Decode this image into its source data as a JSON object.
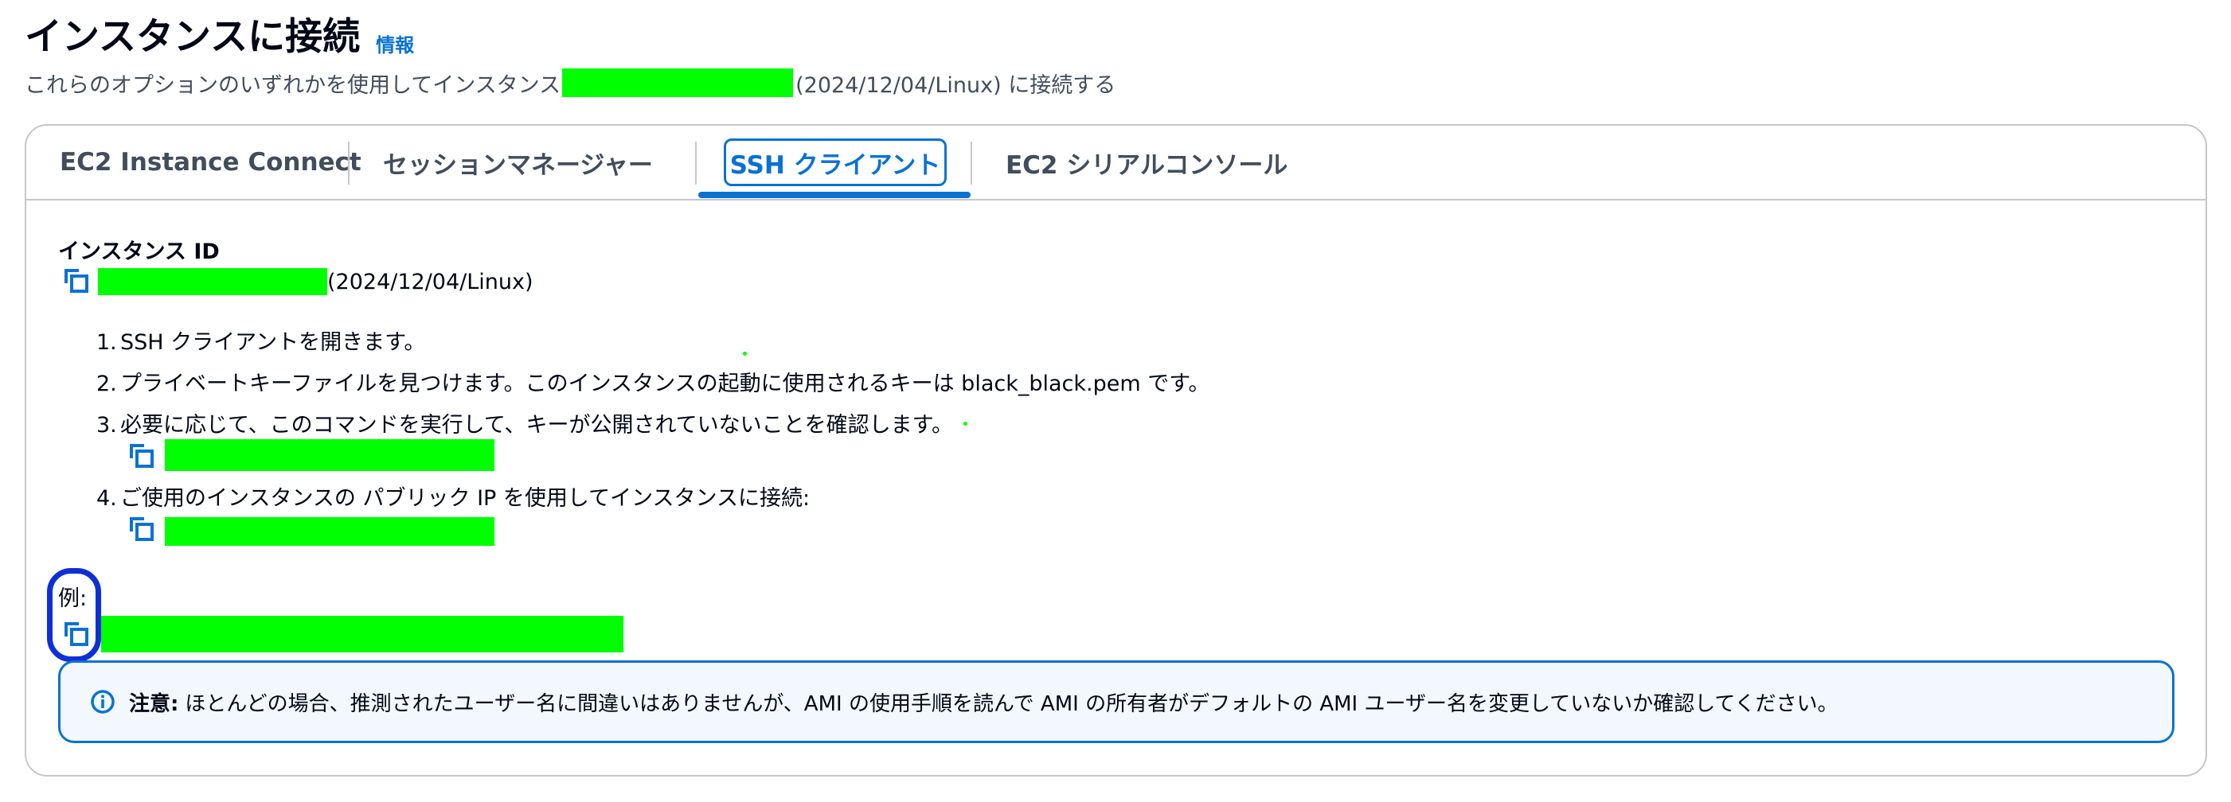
{
  "header": {
    "title": "インスタンスに接続",
    "info_link": "情報",
    "subtitle_prefix": "これらのオプションのいずれかを使用してインスタンス",
    "subtitle_suffix": "(2024/12/04/Linux) に接続する"
  },
  "tabs": [
    {
      "label": "EC2 Instance Connect"
    },
    {
      "label": "セッションマネージャー"
    },
    {
      "label": "SSH クライアント"
    },
    {
      "label": "EC2 シリアルコンソール"
    }
  ],
  "instance": {
    "label": "インスタンス ID",
    "suffix": "(2024/12/04/Linux)"
  },
  "steps": [
    {
      "num": "1.",
      "text": "SSH クライアントを開きます。"
    },
    {
      "num": "2.",
      "text": "プライベートキーファイルを見つけます。このインスタンスの起動に使用されるキーは black_black.pem です。"
    },
    {
      "num": "3.",
      "text": "必要に応じて、このコマンドを実行して、キーが公開されていないことを確認します。"
    },
    {
      "num": "4.",
      "text": "ご使用のインスタンスの パブリック IP を使用してインスタンスに接続:"
    }
  ],
  "example": {
    "label": "例:"
  },
  "alert": {
    "icon": "info-icon",
    "bold": "注意:",
    "text": "ほとんどの場合、推測されたユーザー名に間違いはありませんが、AMI の使用手順を読んで AMI の所有者がデフォルトの AMI ユーザー名を変更していないか確認してください。"
  },
  "colors": {
    "accent": "#0972d3",
    "focus": "#0f2fd6",
    "redaction": "#00ff00",
    "alert_bg": "#f2f8fd"
  }
}
